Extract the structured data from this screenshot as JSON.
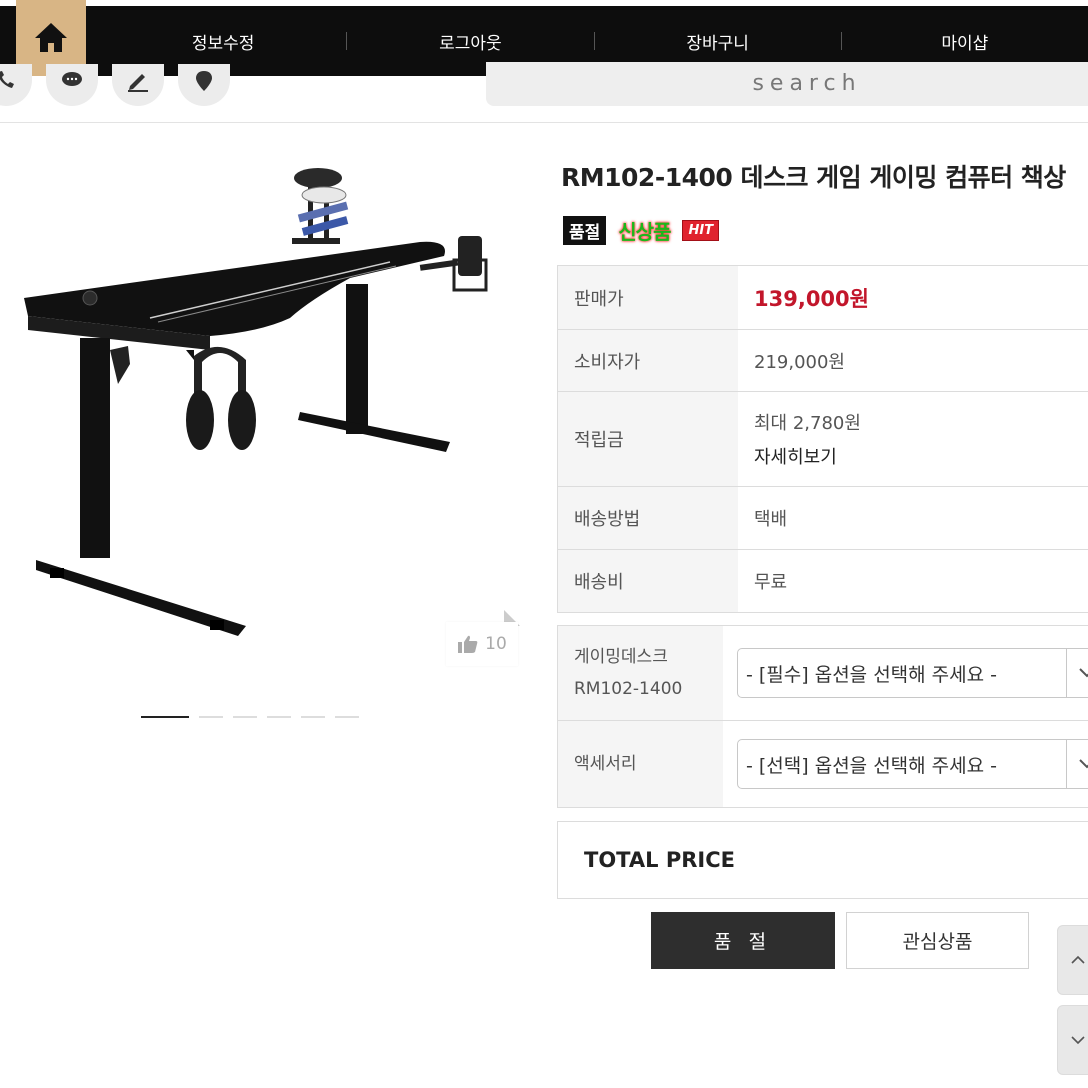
{
  "nav": {
    "items": [
      "정보수정",
      "로그아웃",
      "장바구니",
      "마이샵"
    ]
  },
  "search": {
    "placeholder": "search"
  },
  "product": {
    "title": "RM102-1400 데스크 게임 게이밍 컴퓨터 책상",
    "badges": {
      "soldout": "품절",
      "new": "신상품",
      "hit": "HIT"
    },
    "likes": "10"
  },
  "info": {
    "rows": [
      {
        "label": "판매가",
        "value": "139,000원"
      },
      {
        "label": "소비자가",
        "value": "219,000원"
      },
      {
        "label": "적립금",
        "value": "최대 2,780원",
        "link": "자세히보기"
      },
      {
        "label": "배송방법",
        "value": "택배"
      },
      {
        "label": "배송비",
        "value": "무료"
      }
    ]
  },
  "options": {
    "rows": [
      {
        "label_line1": "게이밍데스크",
        "label_line2": "RM102-1400",
        "selected": "- [필수] 옵션을 선택해 주세요 -"
      },
      {
        "label_line1": "액세서리",
        "selected": "- [선택] 옵션을 선택해 주세요 -"
      }
    ]
  },
  "total": {
    "label": "TOTAL PRICE"
  },
  "buttons": {
    "soldout": "품 절",
    "wishlist": "관심상품"
  },
  "colors": {
    "sale_price": "#c2162b",
    "nav_bg": "#0d0d0d",
    "home_bg": "#d8b585"
  }
}
